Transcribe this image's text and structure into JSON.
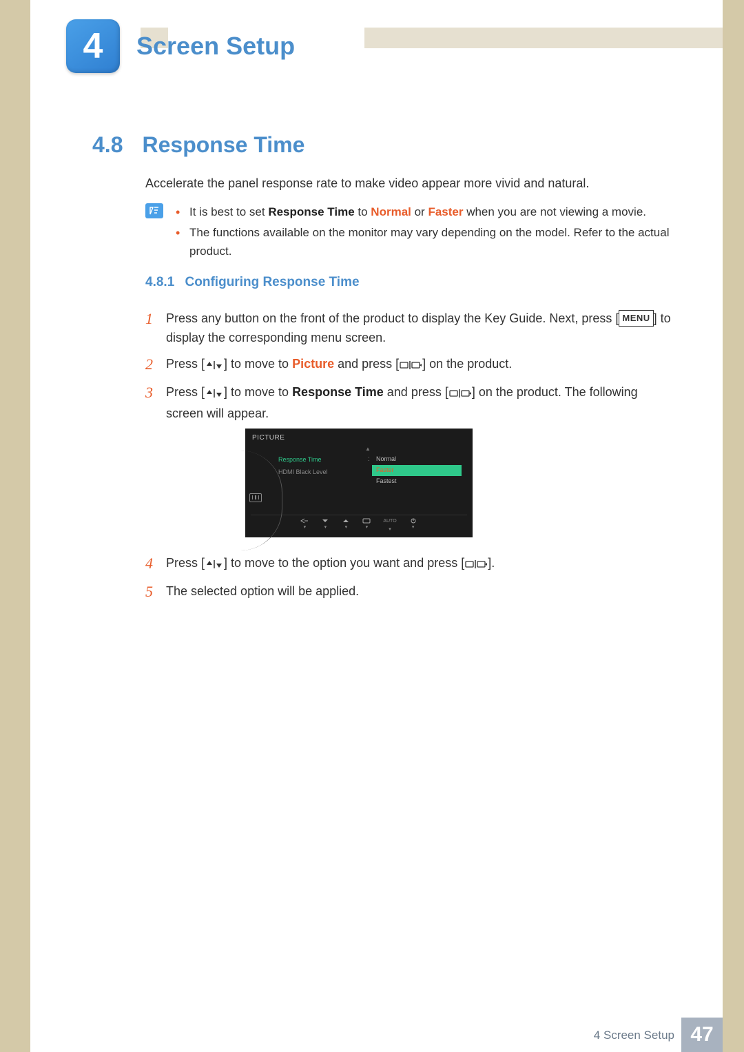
{
  "chapter": {
    "number": "4",
    "title": "Screen Setup"
  },
  "section": {
    "number": "4.8",
    "title": "Response Time"
  },
  "intro": "Accelerate the panel response rate to make video appear more vivid and natural.",
  "notes": {
    "n1_a": "It is best to set ",
    "n1_rt": "Response Time",
    "n1_b": " to ",
    "n1_normal": "Normal",
    "n1_c": " or ",
    "n1_faster": "Faster",
    "n1_d": " when you are not viewing a movie.",
    "n2": "The functions available on the monitor may vary depending on the model. Refer to the actual product."
  },
  "subsection": {
    "number": "4.8.1",
    "title": "Configuring Response Time"
  },
  "steps": {
    "s1_a": "Press any button on the front of the product to display the Key Guide. Next, press [",
    "s1_menu": "MENU",
    "s1_b": "] to display the corresponding menu screen.",
    "s2_a": "Press [",
    "s2_b": "] to move to ",
    "s2_pic": "Picture",
    "s2_c": " and press [",
    "s2_d": "] on the product.",
    "s3_a": "Press [",
    "s3_b": "] to move to ",
    "s3_rt": "Response Time",
    "s3_c": " and press [",
    "s3_d": "] on the product. The following screen will appear.",
    "s4_a": "Press [",
    "s4_b": "] to move to the option you want and press [",
    "s4_c": "].",
    "s5": "The selected option will be applied."
  },
  "step_nums": {
    "n1": "1",
    "n2": "2",
    "n3": "3",
    "n4": "4",
    "n5": "5"
  },
  "osd": {
    "title": "PICTURE",
    "item1": "Response Time",
    "item2": "HDMI Black Level",
    "val1": "Normal",
    "val2": "Faster",
    "val3": "Fastest",
    "auto": "AUTO"
  },
  "footer": {
    "label": "4 Screen Setup",
    "page": "47"
  }
}
